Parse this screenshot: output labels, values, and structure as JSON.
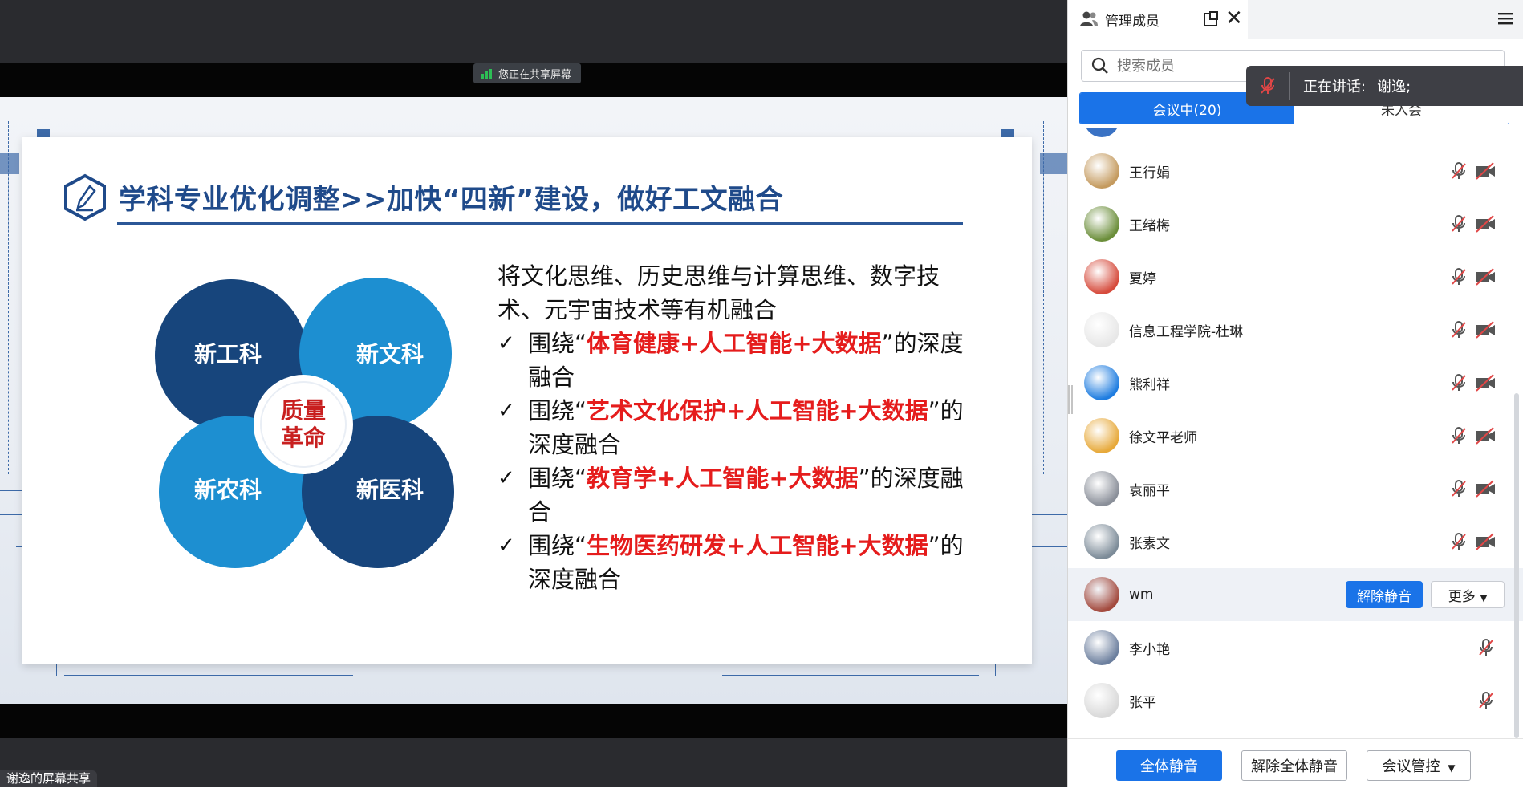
{
  "share": {
    "status": "您正在共享屏幕",
    "tray_label": "谢逸的屏幕共享"
  },
  "slide": {
    "title": "学科专业优化调整>>加快“四新”建设，做好工文融合",
    "diagram": {
      "center": "质量革命",
      "center_line1": "质量",
      "center_line2": "革命",
      "quadrants": [
        "新工科",
        "新文科",
        "新农科",
        "新医科"
      ]
    },
    "intro": "将文化思维、历史思维与计算思维、数字技术、元宇宙技术等有机融合",
    "bullets": [
      {
        "pre": "围绕“",
        "highlight": "体育健康+人工智能+大数据",
        "post": "”的深度融合"
      },
      {
        "pre": "围绕“",
        "highlight": "艺术文化保护+人工智能+大数据",
        "post": "”的深度融合"
      },
      {
        "pre": "围绕“",
        "highlight": "教育学+人工智能+大数据",
        "post": "”的深度融合"
      },
      {
        "pre": "围绕“",
        "highlight": "生物医药研发+人工智能+大数据",
        "post": "”的深度融合"
      }
    ],
    "check_glyph": "✓"
  },
  "panel": {
    "title": "管理成员",
    "search_placeholder": "搜索成员",
    "tabs": [
      {
        "label": "会议中(20)"
      },
      {
        "label": "未入会"
      }
    ],
    "speaking_label": "正在讲话:",
    "speaking_name": "谢逸;",
    "members": [
      {
        "name": "王行娟"
      },
      {
        "name": "王绪梅"
      },
      {
        "name": "夏婷"
      },
      {
        "name": "信息工程学院-杜琳"
      },
      {
        "name": "熊利祥"
      },
      {
        "name": "徐文平老师"
      },
      {
        "name": "袁丽平"
      },
      {
        "name": "张素文"
      },
      {
        "name": "wm",
        "unmute_label": "解除静音",
        "more_label": "更多"
      },
      {
        "name": "李小艳"
      },
      {
        "name": "张平"
      }
    ],
    "footer": {
      "mute_all": "全体静音",
      "unmute_all": "解除全体静音",
      "control": "会议管控"
    }
  },
  "colors": {
    "accent": "#1a73e8",
    "slide_title": "#1f4a8a",
    "highlight_red": "#e51c1c",
    "dark_blue": "#17457c",
    "light_blue": "#1d8fd1"
  },
  "icons": [
    "members-icon",
    "popout-icon",
    "close-icon",
    "menu-icon",
    "search-icon",
    "mic-off-icon",
    "camera-off-icon",
    "chevron-down-icon",
    "signal-icon",
    "pencil-badge-icon"
  ]
}
